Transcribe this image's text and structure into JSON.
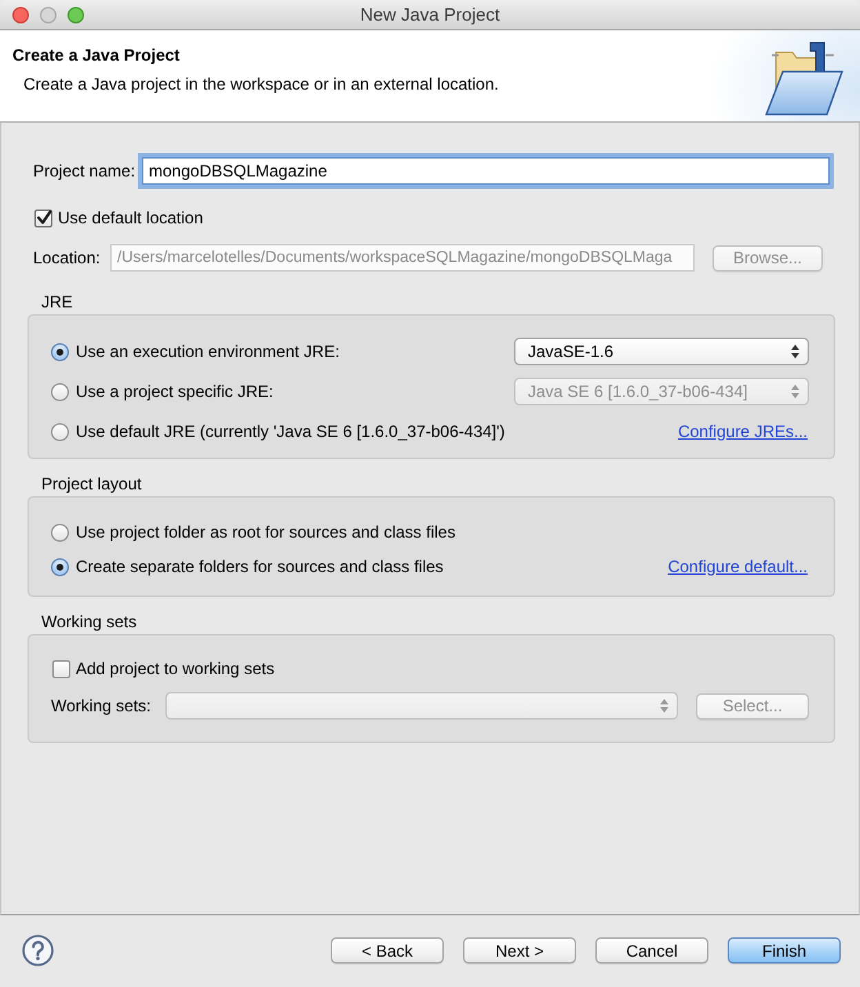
{
  "window": {
    "title": "New Java Project"
  },
  "header": {
    "title": "Create a Java Project",
    "description": "Create a Java project in the workspace or in an external location."
  },
  "project_name": {
    "label": "Project name:",
    "value": "mongoDBSQLMagazine",
    "focused": true
  },
  "use_default_location": {
    "label": "Use default location",
    "checked": true
  },
  "location": {
    "label": "Location:",
    "value": "/Users/marcelotelles/Documents/workspaceSQLMagazine/mongoDBSQLMaga",
    "disabled": true,
    "button": {
      "label": "Browse...",
      "disabled": true
    }
  },
  "jre": {
    "title": "JRE",
    "options": [
      {
        "label": "Use an execution environment JRE:",
        "selected": true,
        "kind": "dropdown",
        "dropdown": {
          "value": "JavaSE-1.6",
          "disabled": false
        }
      },
      {
        "label": "Use a project specific JRE:",
        "selected": false,
        "kind": "dropdown",
        "dropdown": {
          "value": "Java SE 6 [1.6.0_37-b06-434]",
          "disabled": true
        }
      },
      {
        "label": "Use default JRE (currently 'Java SE 6 [1.6.0_37-b06-434]')",
        "selected": false,
        "kind": "link",
        "link": "Configure JREs..."
      }
    ]
  },
  "project_layout": {
    "title": "Project layout",
    "options": [
      {
        "label": "Use project folder as root for sources and class files",
        "selected": false,
        "kind": "plain"
      },
      {
        "label": "Create separate folders for sources and class files",
        "selected": true,
        "kind": "link",
        "link": "Configure default..."
      }
    ]
  },
  "working_sets": {
    "title": "Working sets",
    "add_to_working_sets": {
      "label": "Add project to working sets",
      "checked": false
    },
    "label": "Working sets:",
    "dropdown": {
      "disabled": true
    },
    "button": {
      "label": "Select...",
      "disabled": true
    }
  },
  "buttons": [
    {
      "label": "< Back",
      "default": false
    },
    {
      "label": "Next >",
      "default": false
    },
    {
      "label": "Cancel",
      "default": false
    },
    {
      "label": "Finish",
      "default": true
    }
  ]
}
